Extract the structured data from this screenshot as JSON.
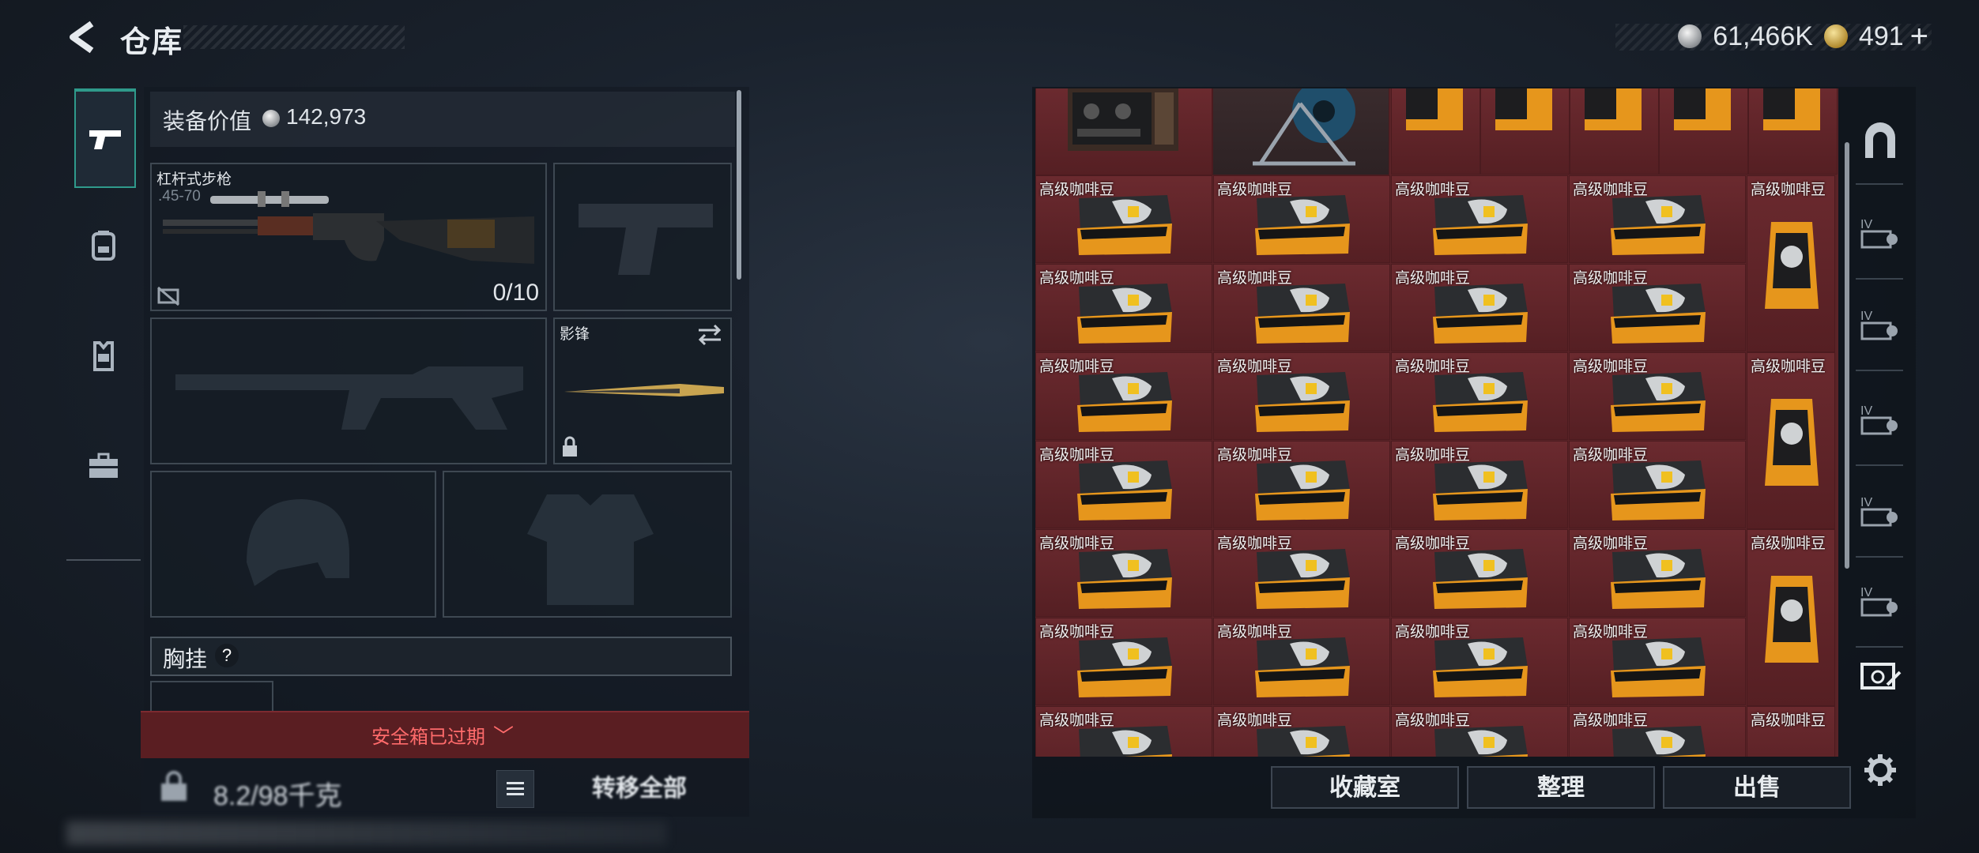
{
  "header": {
    "title": "仓库"
  },
  "currency": {
    "silver": "61,466K",
    "gold": "491",
    "plus": "+"
  },
  "equipment": {
    "value_label": "装备价值",
    "value": "142,973",
    "rifle": {
      "name": "杠杆式步枪",
      "caliber": ".45-70",
      "ammo": "0/10"
    },
    "melee": {
      "name": "影锋"
    },
    "chest_label": "胸挂",
    "chest_help": "?",
    "safe_expired": "安全箱已过期",
    "safe_chevron": "﹀",
    "capacity": "8.2/98千克",
    "transfer_all": "转移全部"
  },
  "grid": {
    "item_name": "高级咖啡豆"
  },
  "buttons": {
    "collection": "收藏室",
    "organize": "整理",
    "sell": "出售"
  },
  "icons": {
    "left_nav": [
      "pistol-icon",
      "backpack-icon",
      "vest-icon",
      "briefcase-icon"
    ],
    "right_nav": [
      "storage-arch-icon",
      "container-iv-icon",
      "container-iv-icon",
      "container-iv-icon",
      "container-iv-icon",
      "container-iv-icon",
      "container-edit-icon",
      "gear-icon"
    ]
  },
  "colors": {
    "accent_teal": "#2f9a8b",
    "grid_red": "#5a2327",
    "warning_red": "#ff6b6b"
  }
}
